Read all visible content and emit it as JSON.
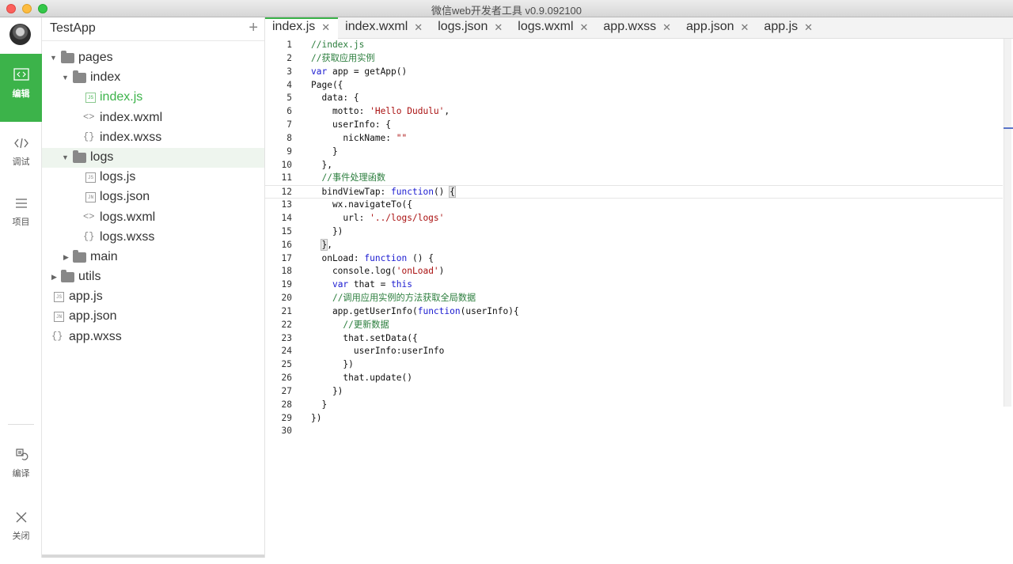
{
  "window": {
    "title": "微信web开发者工具 v0.9.092100"
  },
  "activity": {
    "items": [
      {
        "label": "编辑",
        "icon": "code-icon",
        "active": true
      },
      {
        "label": "调试",
        "icon": "debug-icon",
        "active": false
      },
      {
        "label": "项目",
        "icon": "menu-icon",
        "active": false
      }
    ],
    "bottom": [
      {
        "label": "编译",
        "icon": "compile-icon"
      },
      {
        "label": "关闭",
        "icon": "close-icon"
      }
    ]
  },
  "explorer": {
    "title": "TestApp",
    "add_icon": "plus-icon",
    "tree": [
      {
        "label": "pages",
        "type": "folder",
        "expanded": true,
        "depth": 0
      },
      {
        "label": "index",
        "type": "folder",
        "expanded": true,
        "depth": 1
      },
      {
        "label": "index.js",
        "type": "js",
        "depth": 2,
        "active": true
      },
      {
        "label": "index.wxml",
        "type": "wxml",
        "depth": 2
      },
      {
        "label": "index.wxss",
        "type": "wxss",
        "depth": 2
      },
      {
        "label": "logs",
        "type": "folder",
        "expanded": true,
        "depth": 1,
        "selected": true
      },
      {
        "label": "logs.js",
        "type": "js",
        "depth": 2
      },
      {
        "label": "logs.json",
        "type": "json",
        "depth": 2
      },
      {
        "label": "logs.wxml",
        "type": "wxml",
        "depth": 2
      },
      {
        "label": "logs.wxss",
        "type": "wxss",
        "depth": 2
      },
      {
        "label": "main",
        "type": "folder",
        "expanded": false,
        "depth": 1
      },
      {
        "label": "utils",
        "type": "folder",
        "expanded": false,
        "depth": 0
      },
      {
        "label": "app.js",
        "type": "js",
        "depth": 0
      },
      {
        "label": "app.json",
        "type": "json",
        "depth": 0
      },
      {
        "label": "app.wxss",
        "type": "wxss",
        "depth": 0
      }
    ]
  },
  "tabs": [
    {
      "label": "index.js",
      "active": true
    },
    {
      "label": "index.wxml"
    },
    {
      "label": "logs.json"
    },
    {
      "label": "logs.wxml"
    },
    {
      "label": "app.wxss"
    },
    {
      "label": "app.json"
    },
    {
      "label": "app.js"
    }
  ],
  "editor": {
    "current_line": 12,
    "lines": [
      "//index.js",
      "//获取应用实例",
      "var app = getApp()",
      "Page({",
      "  data: {",
      "    motto: 'Hello Dudulu',",
      "    userInfo: {",
      "      nickName: \"\"",
      "    }",
      "  },",
      "  //事件处理函数",
      "  bindViewTap: function() {",
      "    wx.navigateTo({",
      "      url: '../logs/logs'",
      "    })",
      "  },",
      "  onLoad: function () {",
      "    console.log('onLoad')",
      "    var that = this",
      "    //调用应用实例的方法获取全局数据",
      "    app.getUserInfo(function(userInfo){",
      "      //更新数据",
      "      that.setData({",
      "        userInfo:userInfo",
      "      })",
      "      that.update()",
      "    })",
      "  }",
      "})",
      ""
    ]
  },
  "colors": {
    "accent": "#3cb34a",
    "comment": "#2a7d3c",
    "keyword": "#1b1bd1",
    "string": "#aa1111"
  }
}
